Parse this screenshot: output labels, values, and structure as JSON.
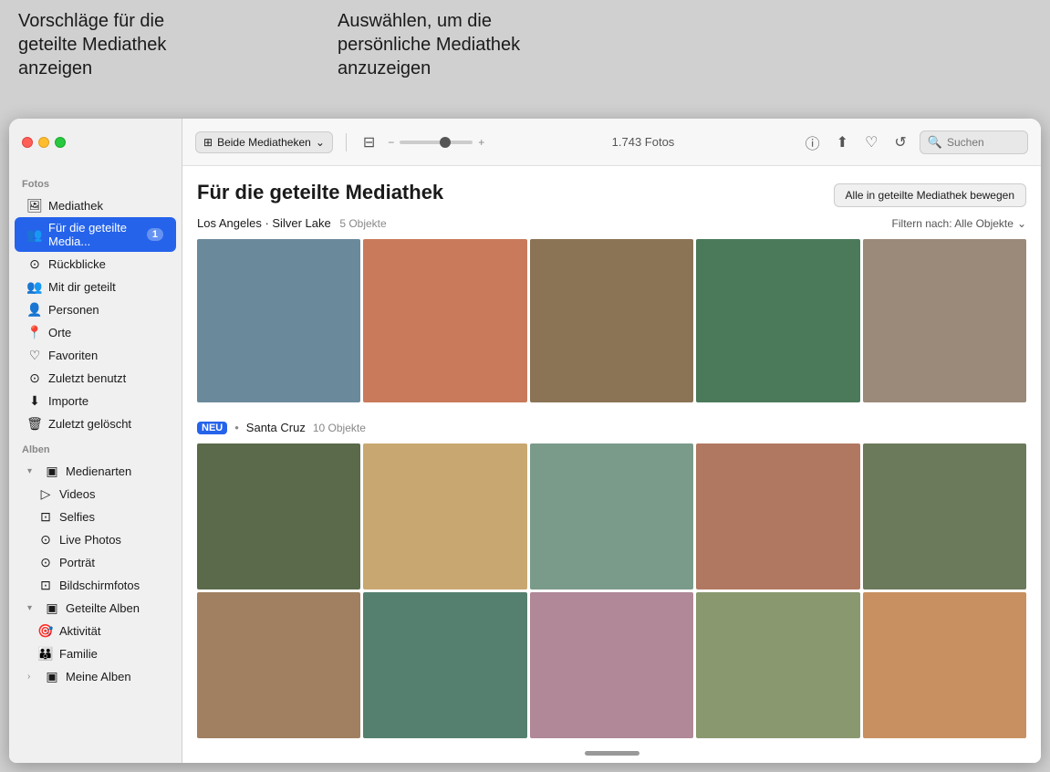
{
  "annotations": {
    "left": "Vorschläge für die\ngeteilte Mediathek\nanzeigen",
    "right": "Auswählen, um die\npersönliche Mediathek\nanzuzeigen"
  },
  "window": {
    "traffic_lights": [
      "red",
      "yellow",
      "green"
    ]
  },
  "toolbar": {
    "library_selector": "Beide Mediatheken",
    "library_selector_icon": "⊞",
    "count": "1.743 Fotos",
    "search_placeholder": "Suchen",
    "zoom_minus": "−",
    "zoom_plus": "+"
  },
  "sidebar": {
    "section_fotos": "Fotos",
    "items_fotos": [
      {
        "id": "mediathek",
        "label": "Mediathek",
        "icon": "🖼",
        "badge": null,
        "active": false
      },
      {
        "id": "geteilte-mediathek",
        "label": "Für die geteilte Media...",
        "icon": "👥",
        "badge": "1",
        "active": true
      },
      {
        "id": "rueckblicke",
        "label": "Rückblicke",
        "icon": "⊙",
        "badge": null,
        "active": false
      },
      {
        "id": "mit-dir-geteilt",
        "label": "Mit dir geteilt",
        "icon": "👥",
        "badge": null,
        "active": false
      },
      {
        "id": "personen",
        "label": "Personen",
        "icon": "👤",
        "badge": null,
        "active": false
      },
      {
        "id": "orte",
        "label": "Orte",
        "icon": "📍",
        "badge": null,
        "active": false
      },
      {
        "id": "favoriten",
        "label": "Favoriten",
        "icon": "♡",
        "badge": null,
        "active": false
      },
      {
        "id": "zuletzt-benutzt",
        "label": "Zuletzt benutzt",
        "icon": "⊙",
        "badge": null,
        "active": false
      },
      {
        "id": "importe",
        "label": "Importe",
        "icon": "⬇",
        "badge": null,
        "active": false
      },
      {
        "id": "zuletzt-geloescht",
        "label": "Zuletzt gelöscht",
        "icon": "🗑",
        "badge": null,
        "active": false
      }
    ],
    "section_alben": "Alben",
    "alben_medienarten": {
      "label": "Medienarten",
      "icon": "▣",
      "expanded": true,
      "children": [
        {
          "id": "videos",
          "label": "Videos",
          "icon": "▷"
        },
        {
          "id": "selfies",
          "label": "Selfies",
          "icon": "⊡"
        },
        {
          "id": "live-photos",
          "label": "Live Photos",
          "icon": "⊙"
        },
        {
          "id": "portraet",
          "label": "Porträt",
          "icon": "⊙"
        },
        {
          "id": "bildschirmfotos",
          "label": "Bildschirmfotos",
          "icon": "⊡"
        }
      ]
    },
    "alben_geteilte": {
      "label": "Geteilte Alben",
      "icon": "▣",
      "expanded": true,
      "children": [
        {
          "id": "aktivitaet",
          "label": "Aktivität",
          "icon": "🎯"
        },
        {
          "id": "familie",
          "label": "Familie",
          "icon": "👪"
        }
      ]
    },
    "meine_alben": {
      "label": "Meine Alben",
      "icon": "▣",
      "expanded": false
    }
  },
  "content": {
    "title": "Für die geteilte Mediathek",
    "action_button": "Alle in geteilte Mediathek bewegen",
    "location1": "Los Angeles · Silver Lake",
    "location1_count": "5 Objekte",
    "filter_label": "Filtern nach: Alle Objekte",
    "section2_badge": "NEU",
    "section2_location": "Santa Cruz",
    "section2_count": "10 Objekte"
  },
  "photos": {
    "row1_colors": [
      "c1",
      "c2",
      "c3",
      "c4",
      "c5"
    ],
    "row2_colors": [
      "c6",
      "c7",
      "c8",
      "c9",
      "c10"
    ],
    "row3_colors": [
      "c11",
      "c12",
      "c13",
      "c14",
      "c15"
    ],
    "row4_colors": [
      "c16",
      "c17",
      "c18",
      "c19",
      "c20"
    ]
  }
}
